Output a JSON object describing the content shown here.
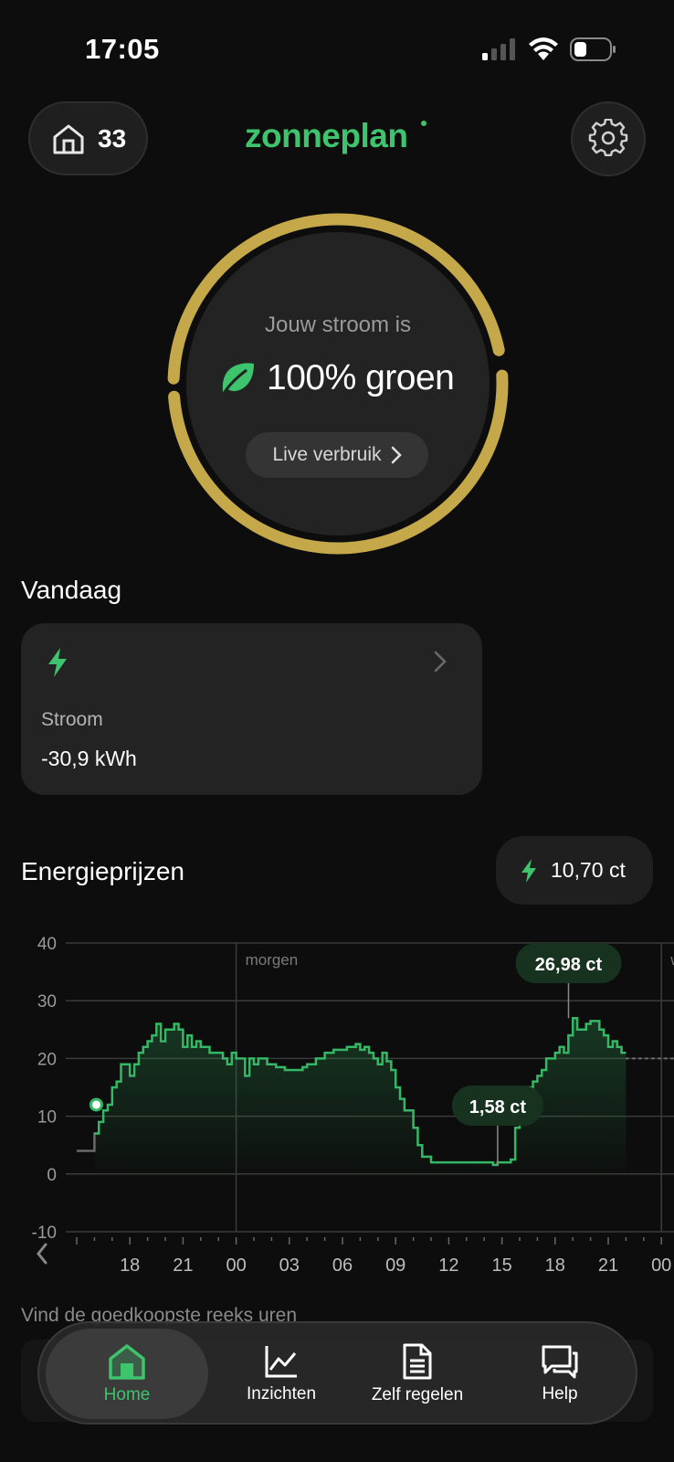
{
  "status_bar": {
    "time": "17:05"
  },
  "header": {
    "home_count": "33",
    "logo": "zonneplan"
  },
  "ring": {
    "subtitle": "Jouw stroom is",
    "main": "100% groen",
    "button": "Live verbruik"
  },
  "today": {
    "title": "Vandaag",
    "label": "Stroom",
    "value": "-30,9 kWh"
  },
  "prices": {
    "title": "Energieprijzen",
    "current": "10,70 ct"
  },
  "chart_data": {
    "type": "line",
    "step": true,
    "title": "",
    "xlabel": "",
    "ylabel": "",
    "ylim": [
      -10,
      40
    ],
    "yticks": [
      "40",
      "30",
      "20",
      "10",
      "0",
      "-10"
    ],
    "xticks": [
      "18",
      "21",
      "00",
      "03",
      "06",
      "09",
      "12",
      "15",
      "18",
      "21",
      "00"
    ],
    "day_labels": [
      "morgen",
      "wo"
    ],
    "grid": true,
    "x": [
      0.0,
      0.25,
      0.5,
      0.75,
      1.0,
      1.25,
      1.5,
      1.75,
      2.0,
      2.25,
      2.5,
      2.75,
      3.0,
      3.25,
      3.5,
      3.75,
      4.0,
      4.25,
      4.5,
      4.75,
      5.0,
      5.25,
      5.5,
      5.75,
      6.0,
      6.25,
      6.5,
      6.75,
      7.0,
      7.25,
      7.5,
      7.75,
      8.0,
      8.25,
      8.5,
      8.75,
      9.0,
      9.25,
      9.5,
      9.75,
      10.0,
      10.25,
      10.5,
      10.75,
      11.0,
      11.25,
      11.5,
      11.75,
      12.0,
      12.25,
      12.5,
      12.75,
      13.0,
      13.25,
      13.5,
      13.75,
      14.0,
      14.25,
      14.5,
      14.75,
      15.0,
      15.25,
      15.5,
      15.75,
      16.0,
      16.25,
      16.5,
      16.75,
      17.0,
      17.25,
      17.5,
      17.75,
      18.0,
      18.25,
      18.5,
      18.75,
      19.0,
      19.25,
      19.5,
      19.75,
      20.0,
      20.25,
      20.5,
      20.75,
      21.0,
      21.25,
      21.5,
      21.75,
      22.0,
      22.25,
      22.5,
      22.75,
      23.0,
      23.25,
      23.5,
      23.75,
      24.0,
      24.25,
      24.5,
      24.75,
      25.0,
      25.25,
      25.5,
      25.75,
      26.0,
      26.25,
      26.5,
      26.75,
      27.0,
      27.25,
      27.5,
      27.75,
      28.0,
      28.25,
      28.5,
      28.75,
      29.0,
      29.25,
      29.5,
      29.75,
      30.0,
      30.25,
      30.5,
      30.75
    ],
    "series": [
      {
        "values": [
          4,
          4,
          4,
          4,
          7,
          9,
          11,
          12,
          15,
          16,
          19,
          19,
          17,
          19,
          21,
          22,
          23,
          24,
          26,
          23,
          25,
          25,
          26,
          25,
          22,
          24,
          22,
          23,
          22,
          22,
          21,
          21,
          21,
          20,
          19,
          21,
          20,
          20,
          17,
          20,
          19,
          20,
          20,
          19,
          19,
          18.5,
          18.5,
          18,
          18,
          18,
          18,
          18.5,
          19,
          19,
          20,
          20,
          21,
          21,
          21.5,
          21.5,
          21.5,
          22,
          22,
          22.5,
          21.5,
          22,
          21,
          20,
          19,
          21,
          19.5,
          18,
          15,
          13,
          11,
          11,
          8,
          5,
          3,
          3,
          2,
          2,
          2,
          2,
          2,
          2,
          2,
          2,
          2,
          2,
          2,
          2,
          2,
          2,
          1.58,
          2,
          2,
          2,
          2.5,
          8,
          13,
          14,
          15,
          16,
          17,
          18,
          20,
          20,
          21,
          22,
          21,
          24,
          26.98,
          25,
          25,
          26,
          26.5,
          26.5,
          25,
          24,
          22,
          23,
          22,
          21,
          20,
          20,
          19,
          20,
          19,
          19,
          19
        ]
      }
    ],
    "now_marker": 1.0,
    "now_value": 12,
    "annotations": [
      {
        "label": "26,98 ct",
        "x": 27.5,
        "y": 26.98
      },
      {
        "label": "1,58 ct",
        "x": 23.5,
        "y": 1.58
      }
    ]
  },
  "cheap_label": "Vind de goedkoopste reeks uren",
  "nav": [
    {
      "label": "Home",
      "icon": "house-icon",
      "active": true
    },
    {
      "label": "Inzichten",
      "icon": "line-chart-icon",
      "active": false
    },
    {
      "label": "Zelf regelen",
      "icon": "document-icon",
      "active": false
    },
    {
      "label": "Help",
      "icon": "chat-bubbles-icon",
      "active": false
    }
  ],
  "colors": {
    "accent_green": "#3ec46d",
    "ring_gold": "#bfa34a",
    "background": "#0d0d0d"
  }
}
